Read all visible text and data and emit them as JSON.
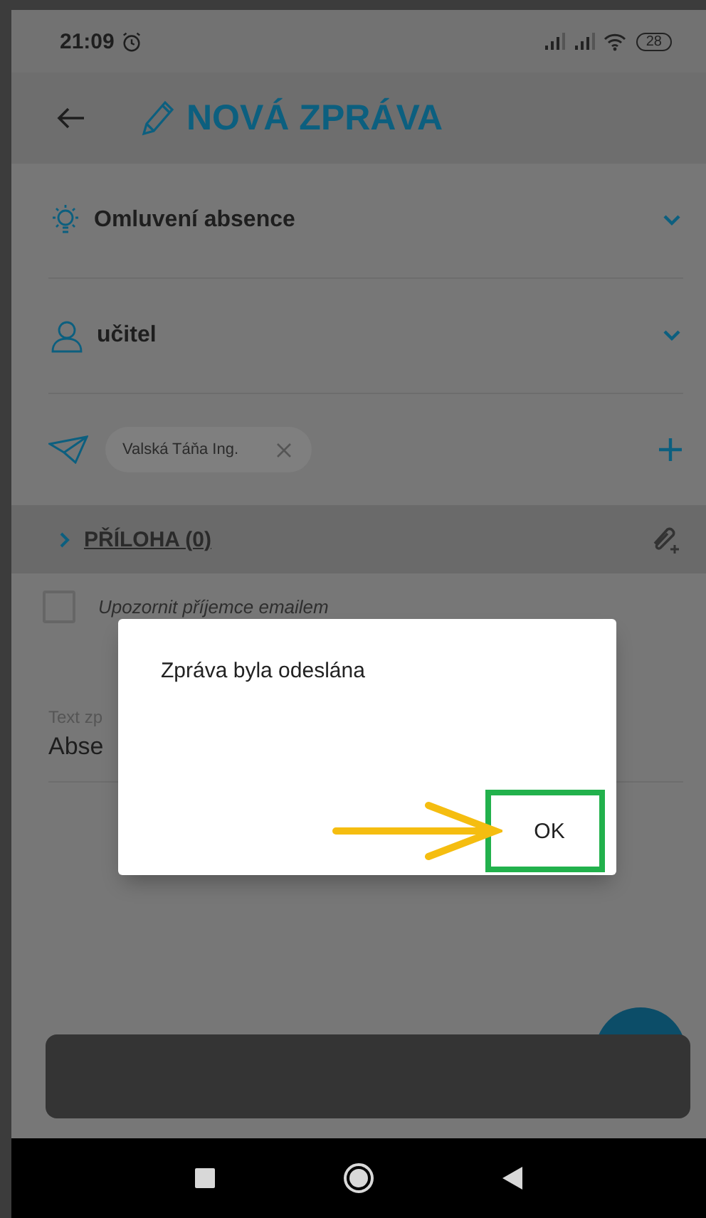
{
  "status_bar": {
    "time": "21:09",
    "battery": "28"
  },
  "header": {
    "title": "NOVÁ ZPRÁVA"
  },
  "fields": [
    {
      "value": "Omluvení absence"
    },
    {
      "value": "učitel"
    }
  ],
  "recipients": {
    "chips": [
      "Valská Táňa Ing."
    ]
  },
  "attachment": {
    "label": "PŘÍLOHA (0)"
  },
  "notify": {
    "label": "Upozornit příjemce emailem",
    "checked": false
  },
  "message": {
    "label": "Text zp",
    "value": "Abse"
  },
  "dialog": {
    "message": "Zpráva byla odeslána",
    "button": "OK"
  }
}
